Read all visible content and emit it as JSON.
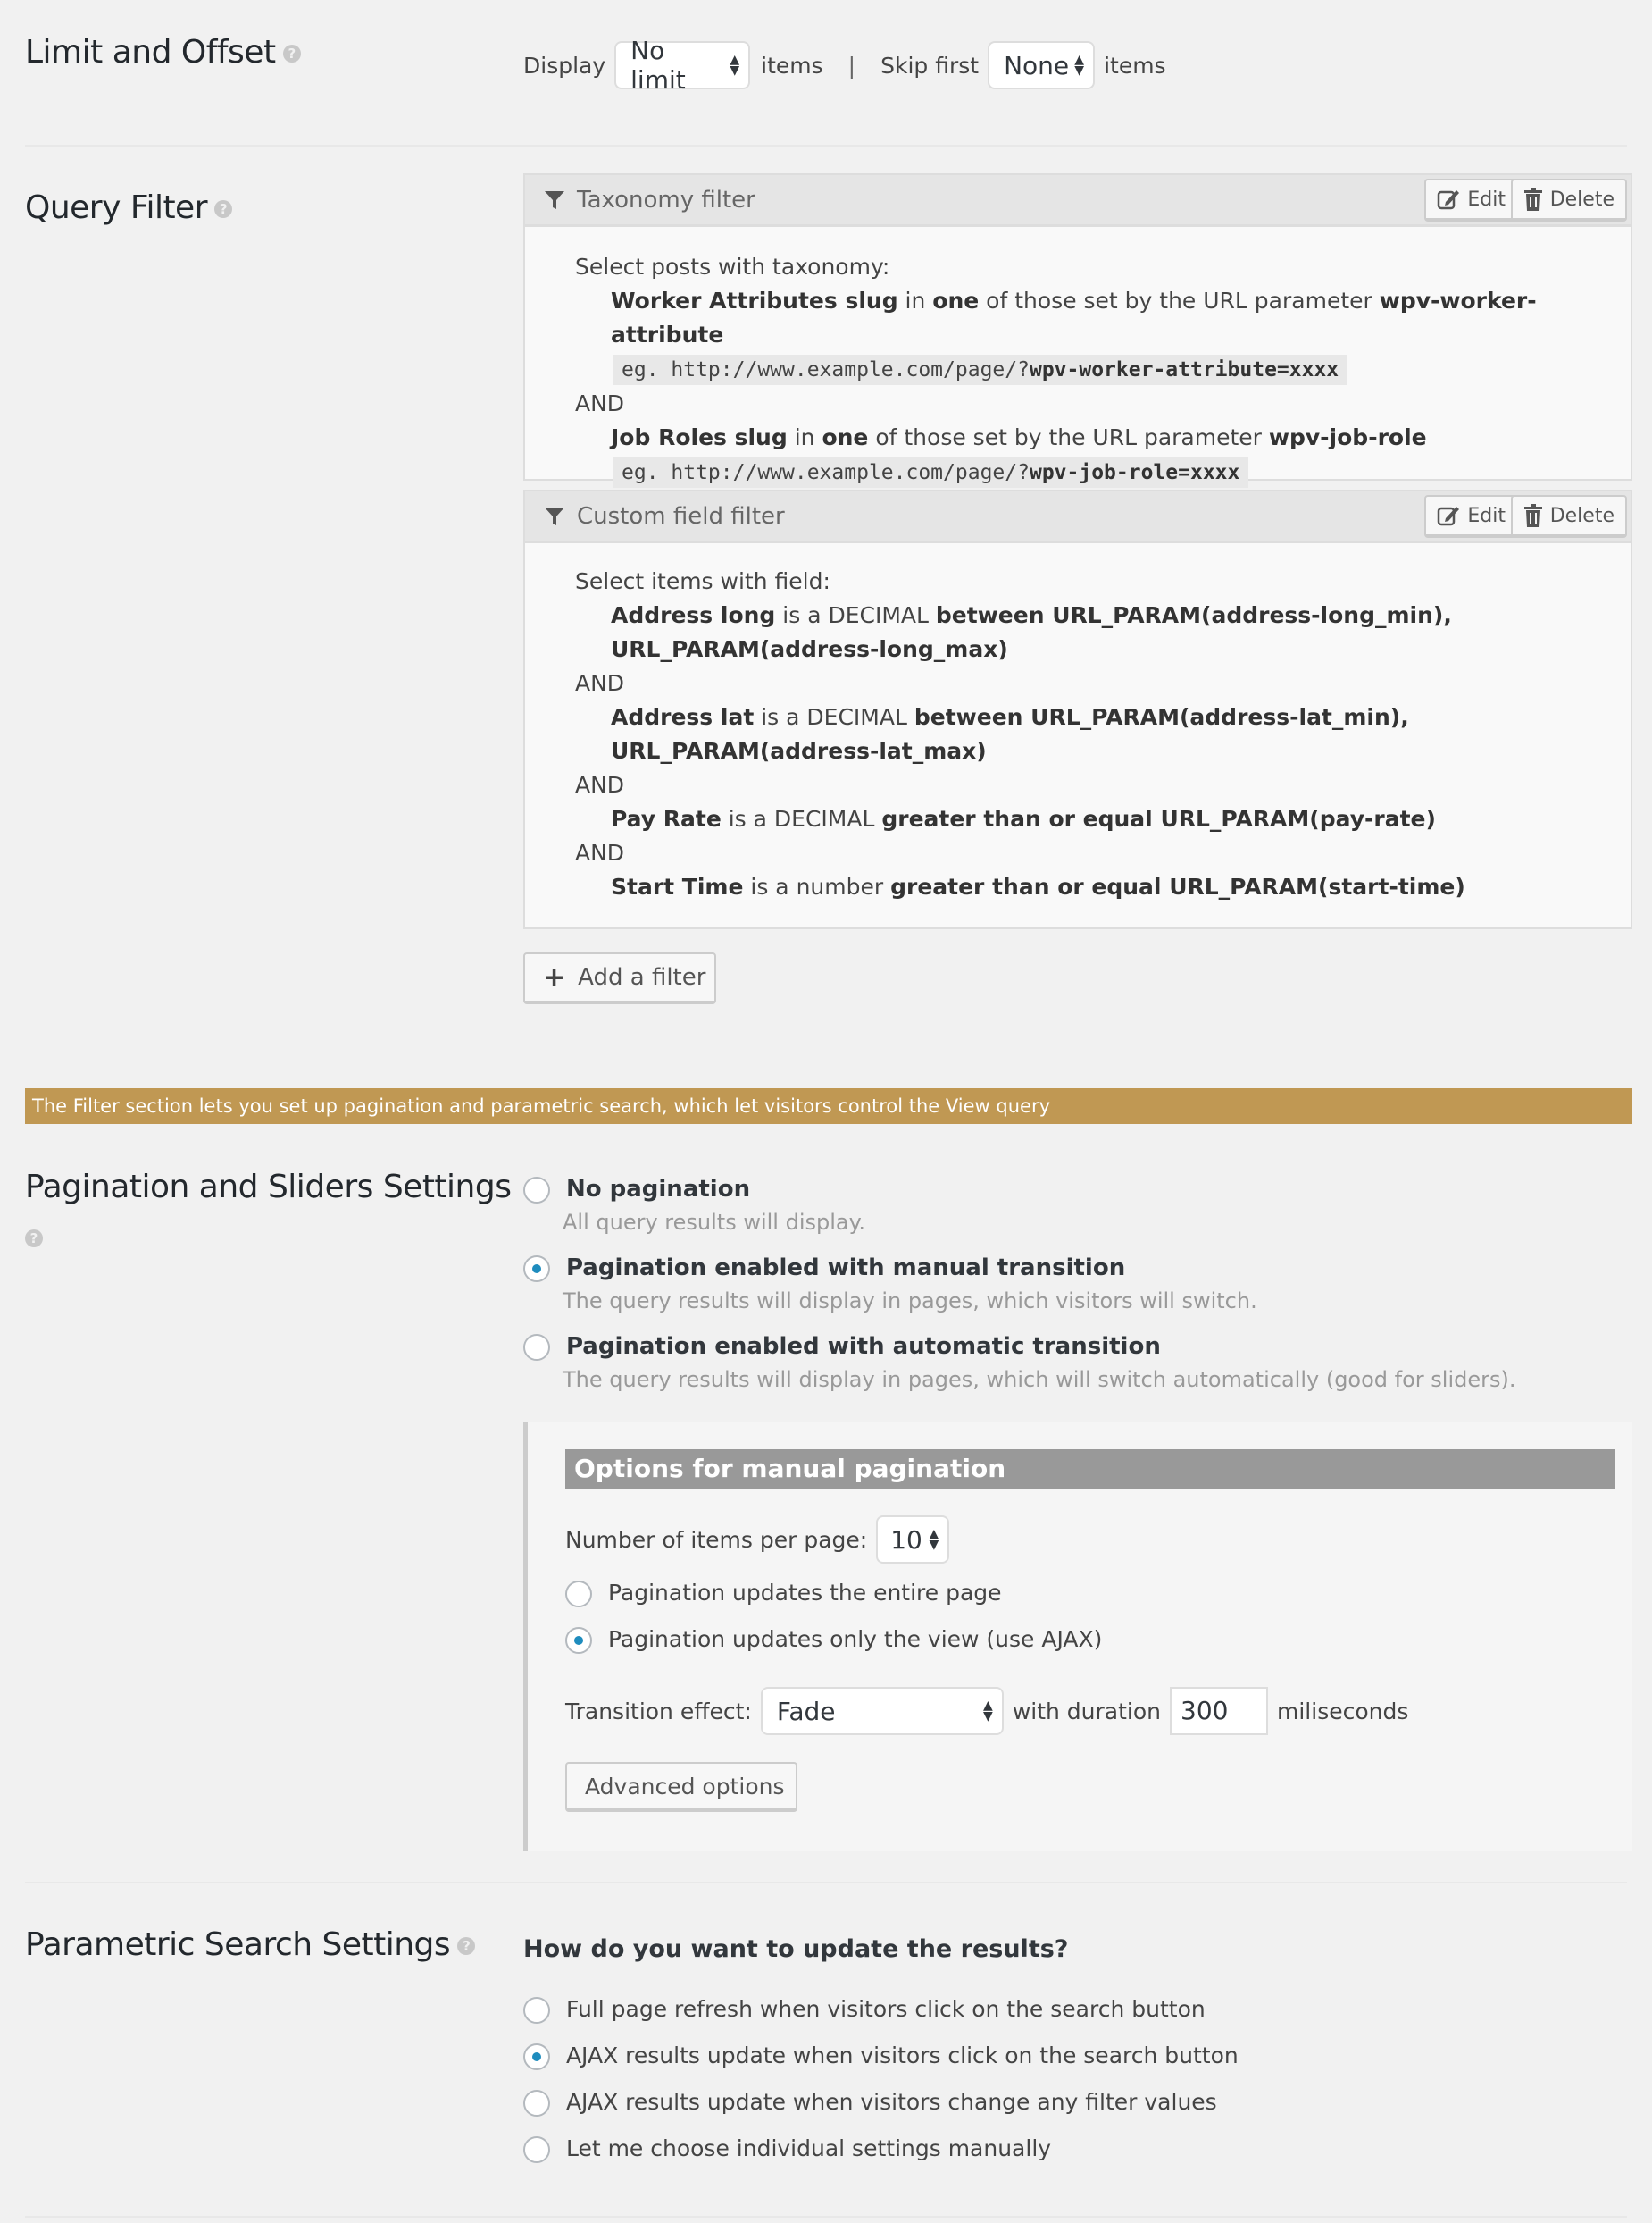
{
  "limit_offset": {
    "title": "Limit and Offset",
    "display_label": "Display",
    "display_value": "No limit",
    "items_label_1": "items",
    "separator": "|",
    "skip_label": "Skip first",
    "skip_value": "None",
    "items_label_2": "items"
  },
  "query_filter": {
    "title": "Query Filter",
    "taxonomy": {
      "header": "Taxonomy filter",
      "edit_label": "Edit",
      "delete_label": "Delete",
      "intro": "Select posts with taxonomy:",
      "conditions": [
        {
          "field": "Worker Attributes slug",
          "mid1": " in ",
          "op": "one",
          "mid2": " of those set by the URL parameter ",
          "param": "wpv-worker-attribute",
          "example_prefix": "eg. http://www.example.com/page/?",
          "example_bold": "wpv-worker-attribute=xxxx"
        },
        {
          "field": "Job Roles slug",
          "mid1": " in ",
          "op": "one",
          "mid2": " of those set by the URL parameter ",
          "param": "wpv-job-role",
          "example_prefix": "eg. http://www.example.com/page/?",
          "example_bold": "wpv-job-role=xxxx"
        }
      ],
      "and_label": "AND"
    },
    "custom_field": {
      "header": "Custom field filter",
      "edit_label": "Edit",
      "delete_label": "Delete",
      "intro": "Select items with field:",
      "and_label": "AND",
      "conditions": [
        {
          "field": "Address long",
          "type": " is a DECIMAL ",
          "rule": "between URL_PARAM(address-long_min), URL_PARAM(address-long_max)"
        },
        {
          "field": "Address lat",
          "type": " is a DECIMAL ",
          "rule": "between URL_PARAM(address-lat_min), URL_PARAM(address-lat_max)"
        },
        {
          "field": "Pay Rate",
          "type": " is a DECIMAL ",
          "rule": "greater than or equal URL_PARAM(pay-rate)"
        },
        {
          "field": "Start Time",
          "type": " is a number ",
          "rule": "greater than or equal URL_PARAM(start-time)"
        }
      ]
    },
    "add_filter_label": "Add a filter"
  },
  "banner": {
    "text": "The Filter section lets you set up pagination and parametric search, which let visitors control the View query",
    "color": "#c09853"
  },
  "pagination": {
    "title": "Pagination and Sliders Settings",
    "options": [
      {
        "label": "No pagination",
        "desc": "All query results will display.",
        "checked": false
      },
      {
        "label": "Pagination enabled with manual transition",
        "desc": "The query results will display in pages, which visitors will switch.",
        "checked": true
      },
      {
        "label": "Pagination enabled with automatic transition",
        "desc": "The query results will display in pages, which will switch automatically (good for sliders).",
        "checked": false
      }
    ],
    "manual": {
      "header": "Options for manual pagination",
      "items_per_page_label": "Number of items per page:",
      "items_per_page_value": "10",
      "update_options": [
        {
          "label": "Pagination updates the entire page",
          "checked": false
        },
        {
          "label": "Pagination updates only the view (use AJAX)",
          "checked": true
        }
      ],
      "transition_label": "Transition effect:",
      "transition_value": "Fade",
      "duration_label": "with duration",
      "duration_value": "300",
      "duration_unit": "miliseconds",
      "advanced_label": "Advanced options"
    }
  },
  "parametric": {
    "title": "Parametric Search Settings",
    "question": "How do you want to update the results?",
    "options": [
      {
        "label": "Full page refresh when visitors click on the search button",
        "checked": false
      },
      {
        "label": "AJAX results update when visitors click on the search button",
        "checked": true
      },
      {
        "label": "AJAX results update when visitors change any filter values",
        "checked": false
      },
      {
        "label": "Let me choose individual settings manually",
        "checked": false
      }
    ]
  },
  "accent_color": "#1e8cbe"
}
